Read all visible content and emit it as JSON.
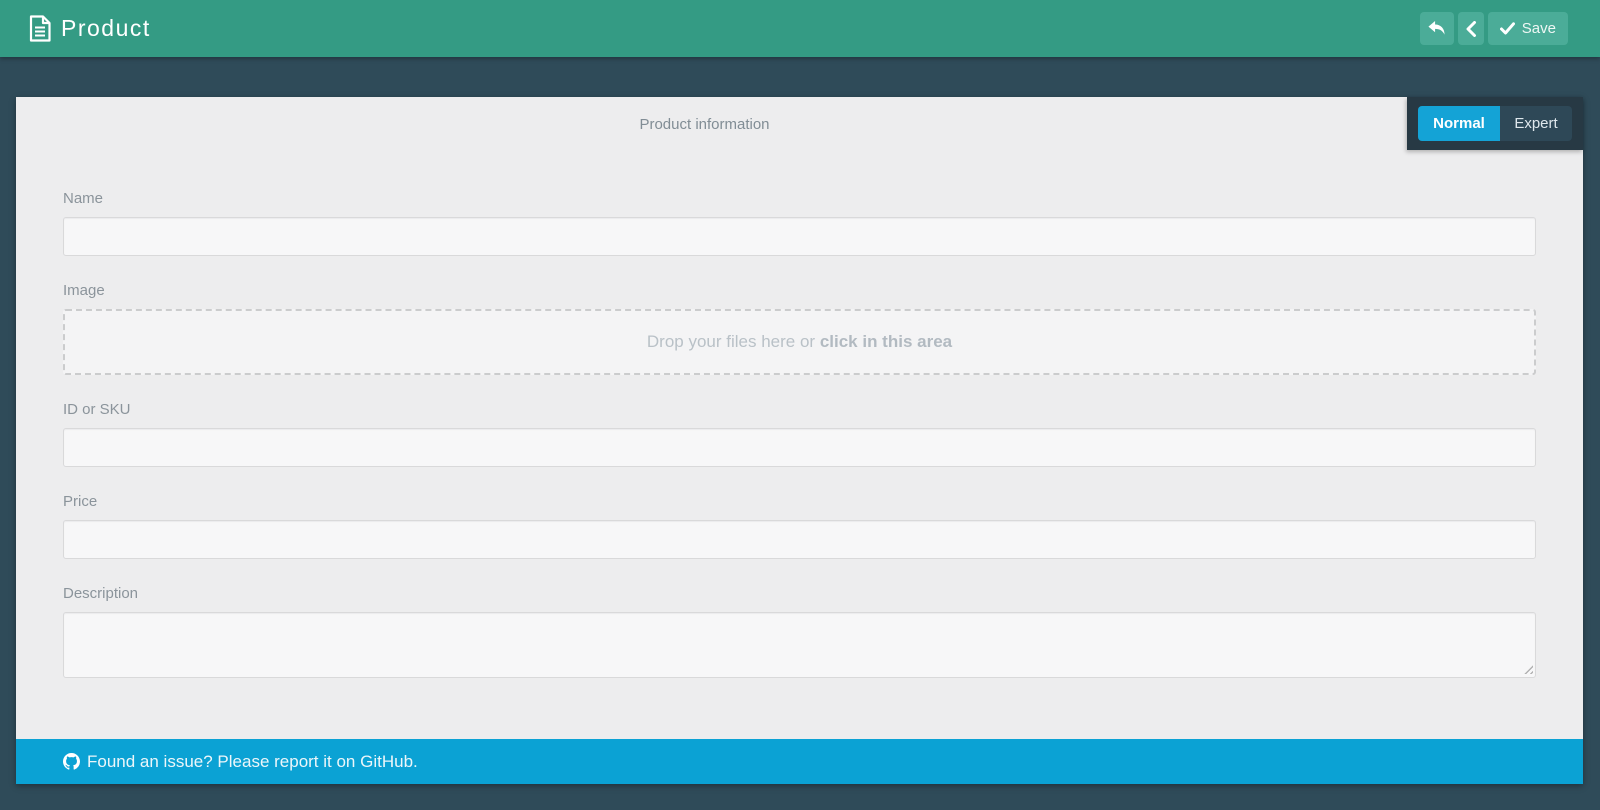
{
  "header": {
    "title": "Product",
    "icon": "document-icon",
    "buttons": [
      {
        "name": "undo",
        "icon": "undo-icon",
        "label": ""
      },
      {
        "name": "back",
        "icon": "chevron-left-icon",
        "label": ""
      },
      {
        "name": "save",
        "icon": "check-icon",
        "label": "Save"
      }
    ]
  },
  "view_toggle": {
    "options": [
      "Normal",
      "Expert"
    ],
    "active": "Normal"
  },
  "form": {
    "title": "Product information",
    "fields": [
      {
        "label": "Name",
        "type": "text",
        "value": ""
      },
      {
        "label": "Image",
        "type": "dropzone",
        "text_normal": "Drop your files here or",
        "text_bold": "click in this area"
      },
      {
        "label": "ID or SKU",
        "type": "text",
        "value": ""
      },
      {
        "label": "Price",
        "type": "text",
        "value": ""
      },
      {
        "label": "Description",
        "type": "textarea",
        "value": ""
      }
    ]
  },
  "footer": {
    "icon": "github-icon",
    "message": "Found an issue? Please report it on GitHub."
  },
  "colors": {
    "header_teal": "#349b84",
    "header_button": "#4bac98",
    "page_bg": "#2f4b59",
    "card_bg": "#ededee",
    "toggle_panel": "#273944",
    "toggle_active": "#14a3d6",
    "toggle_inactive": "#2e4857",
    "footer_blue": "#0ba2d4"
  }
}
